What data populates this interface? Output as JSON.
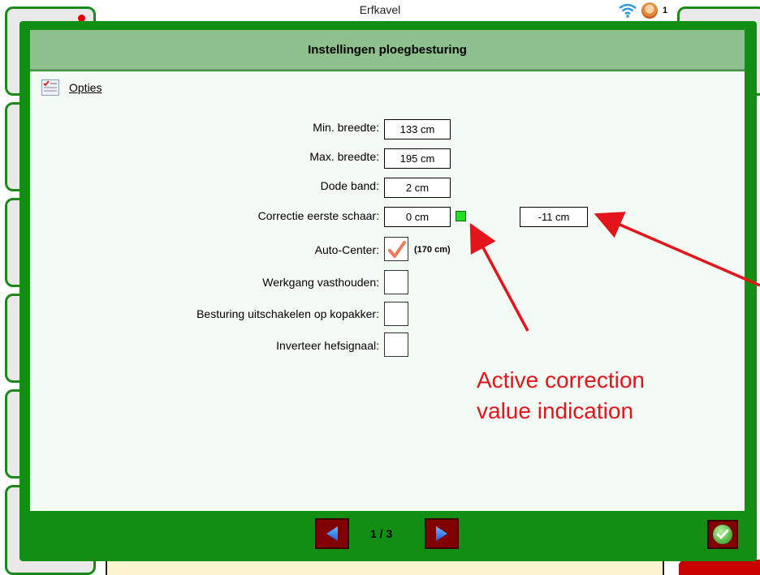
{
  "app": {
    "title": "Erfkavel",
    "status_count": "1"
  },
  "dialog": {
    "title": "Instellingen ploegbesturing",
    "section_label": "Opties",
    "fields": {
      "min_breedte": {
        "label": "Min. breedte:",
        "value": "133 cm"
      },
      "max_breedte": {
        "label": "Max. breedte:",
        "value": "195 cm"
      },
      "dode_band": {
        "label": "Dode band:",
        "value": "2 cm"
      },
      "correctie": {
        "label": "Correctie eerste schaar:",
        "value": "0 cm",
        "extra_value": "-11 cm",
        "indicator_color": "#22dd22"
      }
    },
    "checks": {
      "auto_center": {
        "label": "Auto-Center:",
        "checked": true,
        "extra": "(170 cm)"
      },
      "werkgang": {
        "label": "Werkgang vasthouden:",
        "checked": false
      },
      "besturing": {
        "label": "Besturing uitschakelen op kopakker:",
        "checked": false
      },
      "inverteer": {
        "label": "Inverteer hefsignaal:",
        "checked": false
      }
    },
    "footer": {
      "page": "1 / 3"
    }
  },
  "annotation": {
    "line1": "Active correction",
    "line2": "value indication",
    "color": "#e4151a"
  },
  "colors": {
    "dialog_frame": "#128f12",
    "header": "#8ec08d",
    "body": "#f4fbf4",
    "nav_button": "#800000"
  }
}
